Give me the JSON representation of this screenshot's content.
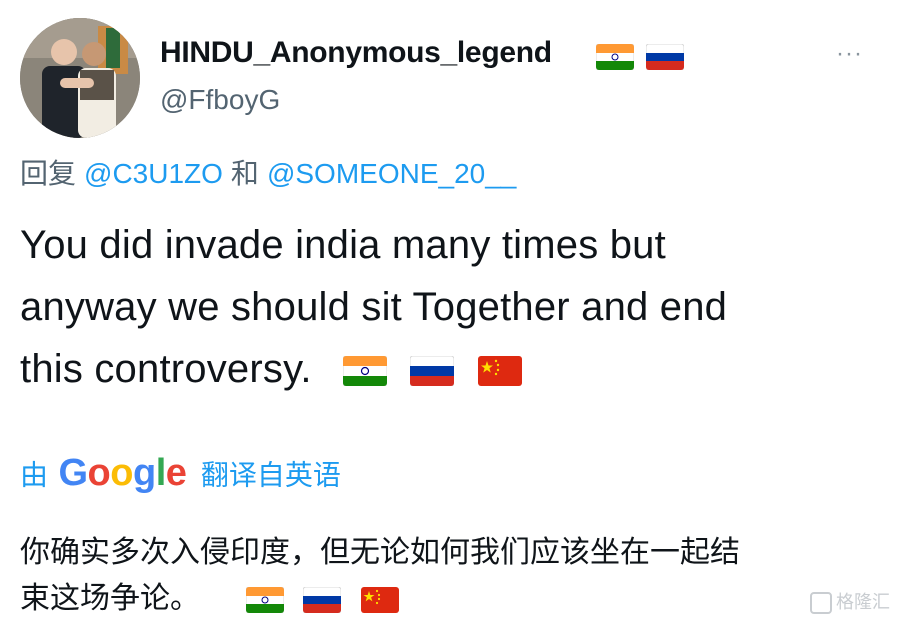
{
  "author": {
    "display_name": "HINDU_Anonymous_legend",
    "handle": "@FfboyG",
    "name_flags": [
      "india-flag",
      "russia-flag"
    ]
  },
  "more_label": "···",
  "reply": {
    "prefix": "回复",
    "mention1": "@C3U1ZO",
    "connector": "和",
    "mention2": "@SOMEONE_20__"
  },
  "tweet": {
    "lines": [
      "You did invade india many times but",
      "anyway we should sit Together and end",
      "this controversy."
    ],
    "flags": [
      "india-flag",
      "russia-flag",
      "china-flag"
    ]
  },
  "translation": {
    "by_label": "由",
    "google_letters": [
      "G",
      "o",
      "o",
      "g",
      "l",
      "e"
    ],
    "google_colors": [
      "#4285f4",
      "#ea4335",
      "#fbbc05",
      "#4285f4",
      "#34a853",
      "#ea4335"
    ],
    "from_label": "翻译自英语",
    "lines": [
      "你确实多次入侵印度，但无论如何我们应该坐在一起结",
      "束这场争论。"
    ],
    "flags": [
      "india-flag",
      "russia-flag",
      "china-flag"
    ]
  },
  "watermark": "格隆汇",
  "colors": {
    "link_blue": "#1d9bf0",
    "secondary_gray": "#536471",
    "text": "#0f1419"
  }
}
